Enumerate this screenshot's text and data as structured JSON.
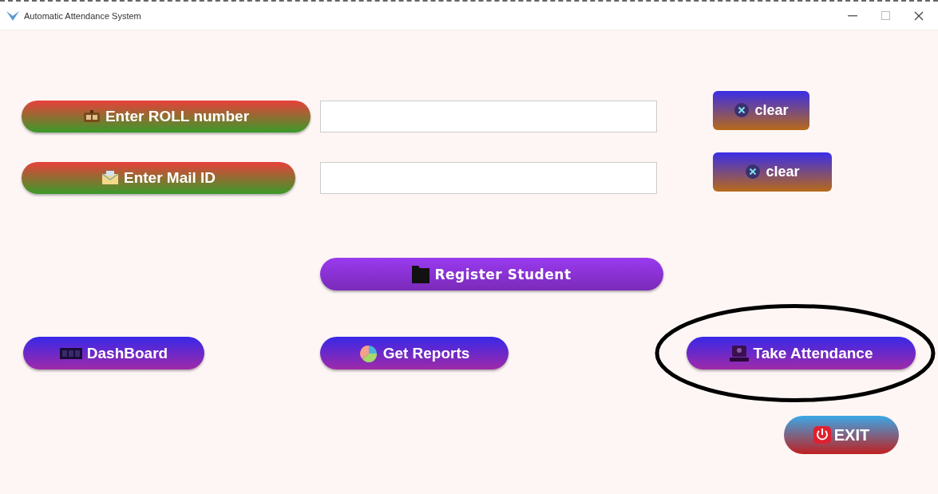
{
  "window": {
    "title": "Automatic Attendance System"
  },
  "fields": [
    {
      "kind": "roll",
      "label": "Enter ROLL number",
      "clear": "clear"
    },
    {
      "kind": "mail",
      "label": "Enter Mail ID",
      "clear": "clear"
    }
  ],
  "register": {
    "label": "Register Student"
  },
  "actions": [
    {
      "kind": "dashboard",
      "label": "DashBoard"
    },
    {
      "kind": "reports",
      "label": "Get Reports"
    },
    {
      "kind": "attendance",
      "label": "Take Attendance",
      "circled": true
    }
  ],
  "exit": {
    "label": "EXIT"
  }
}
